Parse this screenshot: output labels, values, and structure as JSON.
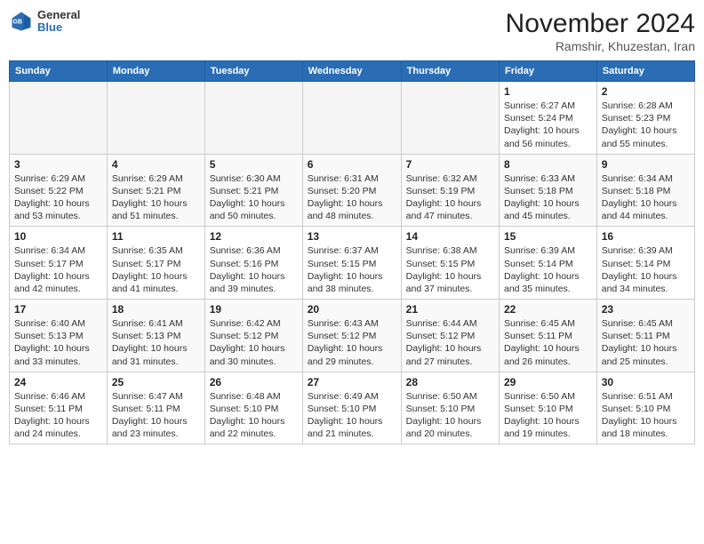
{
  "header": {
    "logo_general": "General",
    "logo_blue": "Blue",
    "month_year": "November 2024",
    "location": "Ramshir, Khuzestan, Iran"
  },
  "weekdays": [
    "Sunday",
    "Monday",
    "Tuesday",
    "Wednesday",
    "Thursday",
    "Friday",
    "Saturday"
  ],
  "weeks": [
    [
      {
        "day": "",
        "info": ""
      },
      {
        "day": "",
        "info": ""
      },
      {
        "day": "",
        "info": ""
      },
      {
        "day": "",
        "info": ""
      },
      {
        "day": "",
        "info": ""
      },
      {
        "day": "1",
        "info": "Sunrise: 6:27 AM\nSunset: 5:24 PM\nDaylight: 10 hours\nand 56 minutes."
      },
      {
        "day": "2",
        "info": "Sunrise: 6:28 AM\nSunset: 5:23 PM\nDaylight: 10 hours\nand 55 minutes."
      }
    ],
    [
      {
        "day": "3",
        "info": "Sunrise: 6:29 AM\nSunset: 5:22 PM\nDaylight: 10 hours\nand 53 minutes."
      },
      {
        "day": "4",
        "info": "Sunrise: 6:29 AM\nSunset: 5:21 PM\nDaylight: 10 hours\nand 51 minutes."
      },
      {
        "day": "5",
        "info": "Sunrise: 6:30 AM\nSunset: 5:21 PM\nDaylight: 10 hours\nand 50 minutes."
      },
      {
        "day": "6",
        "info": "Sunrise: 6:31 AM\nSunset: 5:20 PM\nDaylight: 10 hours\nand 48 minutes."
      },
      {
        "day": "7",
        "info": "Sunrise: 6:32 AM\nSunset: 5:19 PM\nDaylight: 10 hours\nand 47 minutes."
      },
      {
        "day": "8",
        "info": "Sunrise: 6:33 AM\nSunset: 5:18 PM\nDaylight: 10 hours\nand 45 minutes."
      },
      {
        "day": "9",
        "info": "Sunrise: 6:34 AM\nSunset: 5:18 PM\nDaylight: 10 hours\nand 44 minutes."
      }
    ],
    [
      {
        "day": "10",
        "info": "Sunrise: 6:34 AM\nSunset: 5:17 PM\nDaylight: 10 hours\nand 42 minutes."
      },
      {
        "day": "11",
        "info": "Sunrise: 6:35 AM\nSunset: 5:17 PM\nDaylight: 10 hours\nand 41 minutes."
      },
      {
        "day": "12",
        "info": "Sunrise: 6:36 AM\nSunset: 5:16 PM\nDaylight: 10 hours\nand 39 minutes."
      },
      {
        "day": "13",
        "info": "Sunrise: 6:37 AM\nSunset: 5:15 PM\nDaylight: 10 hours\nand 38 minutes."
      },
      {
        "day": "14",
        "info": "Sunrise: 6:38 AM\nSunset: 5:15 PM\nDaylight: 10 hours\nand 37 minutes."
      },
      {
        "day": "15",
        "info": "Sunrise: 6:39 AM\nSunset: 5:14 PM\nDaylight: 10 hours\nand 35 minutes."
      },
      {
        "day": "16",
        "info": "Sunrise: 6:39 AM\nSunset: 5:14 PM\nDaylight: 10 hours\nand 34 minutes."
      }
    ],
    [
      {
        "day": "17",
        "info": "Sunrise: 6:40 AM\nSunset: 5:13 PM\nDaylight: 10 hours\nand 33 minutes."
      },
      {
        "day": "18",
        "info": "Sunrise: 6:41 AM\nSunset: 5:13 PM\nDaylight: 10 hours\nand 31 minutes."
      },
      {
        "day": "19",
        "info": "Sunrise: 6:42 AM\nSunset: 5:12 PM\nDaylight: 10 hours\nand 30 minutes."
      },
      {
        "day": "20",
        "info": "Sunrise: 6:43 AM\nSunset: 5:12 PM\nDaylight: 10 hours\nand 29 minutes."
      },
      {
        "day": "21",
        "info": "Sunrise: 6:44 AM\nSunset: 5:12 PM\nDaylight: 10 hours\nand 27 minutes."
      },
      {
        "day": "22",
        "info": "Sunrise: 6:45 AM\nSunset: 5:11 PM\nDaylight: 10 hours\nand 26 minutes."
      },
      {
        "day": "23",
        "info": "Sunrise: 6:45 AM\nSunset: 5:11 PM\nDaylight: 10 hours\nand 25 minutes."
      }
    ],
    [
      {
        "day": "24",
        "info": "Sunrise: 6:46 AM\nSunset: 5:11 PM\nDaylight: 10 hours\nand 24 minutes."
      },
      {
        "day": "25",
        "info": "Sunrise: 6:47 AM\nSunset: 5:11 PM\nDaylight: 10 hours\nand 23 minutes."
      },
      {
        "day": "26",
        "info": "Sunrise: 6:48 AM\nSunset: 5:10 PM\nDaylight: 10 hours\nand 22 minutes."
      },
      {
        "day": "27",
        "info": "Sunrise: 6:49 AM\nSunset: 5:10 PM\nDaylight: 10 hours\nand 21 minutes."
      },
      {
        "day": "28",
        "info": "Sunrise: 6:50 AM\nSunset: 5:10 PM\nDaylight: 10 hours\nand 20 minutes."
      },
      {
        "day": "29",
        "info": "Sunrise: 6:50 AM\nSunset: 5:10 PM\nDaylight: 10 hours\nand 19 minutes."
      },
      {
        "day": "30",
        "info": "Sunrise: 6:51 AM\nSunset: 5:10 PM\nDaylight: 10 hours\nand 18 minutes."
      }
    ]
  ]
}
